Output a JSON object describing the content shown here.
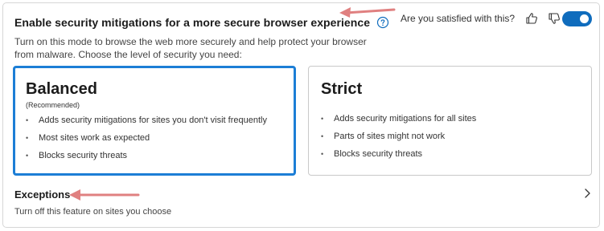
{
  "header": {
    "title": "Enable security mitigations for a more secure browser experience",
    "help_icon": "question-circle-icon",
    "feedback_question": "Are you satisfied with this?",
    "toggle_on": true
  },
  "description": "Turn on this mode to browse the web more securely and help protect your browser from malware. Choose the level of security you need:",
  "cards": {
    "balanced": {
      "title": "Balanced",
      "subtitle": "(Recommended)",
      "selected": true,
      "bullets": [
        "Adds security mitigations for sites you don't visit frequently",
        "Most sites work as expected",
        "Blocks security threats"
      ]
    },
    "strict": {
      "title": "Strict",
      "selected": false,
      "bullets": [
        "Adds security mitigations for all sites",
        "Parts of sites might not work",
        "Blocks security threats"
      ]
    }
  },
  "exceptions": {
    "title": "Exceptions",
    "description": "Turn off this feature on sites you choose"
  },
  "colors": {
    "accent": "#0f6cbd",
    "selected_border": "#1c7ed6",
    "annotation_arrow": "#e08080"
  }
}
